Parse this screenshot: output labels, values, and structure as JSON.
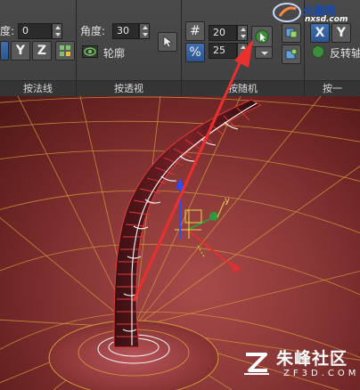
{
  "ribbon": {
    "group_normals": {
      "label_angle": "度:",
      "value": "0",
      "buttons": [
        "Y",
        "Z"
      ],
      "title": "按法线"
    },
    "group_perspective": {
      "label_angle": "角度:",
      "value": "30",
      "outline_label": "轮廓",
      "title": "按透视"
    },
    "group_camera": {
      "value_1": "20",
      "value_2": "25",
      "hash_icon": "#",
      "percent_icon": "%",
      "title": "按随机"
    },
    "group_last": {
      "x_button": "X",
      "y_button": "Y",
      "flip_label": "反转轴",
      "title": "按一"
    }
  },
  "watermarks": {
    "top_site": "nxsd.com",
    "bottom_text": "朱峰社区",
    "bottom_url": "ZF3D.COM"
  },
  "gizmo": {
    "axis_y_label": "y"
  },
  "colors": {
    "arrow": "#e8302e",
    "accent_blue": "#3f6fb1",
    "surface": "#8f3a3a"
  }
}
